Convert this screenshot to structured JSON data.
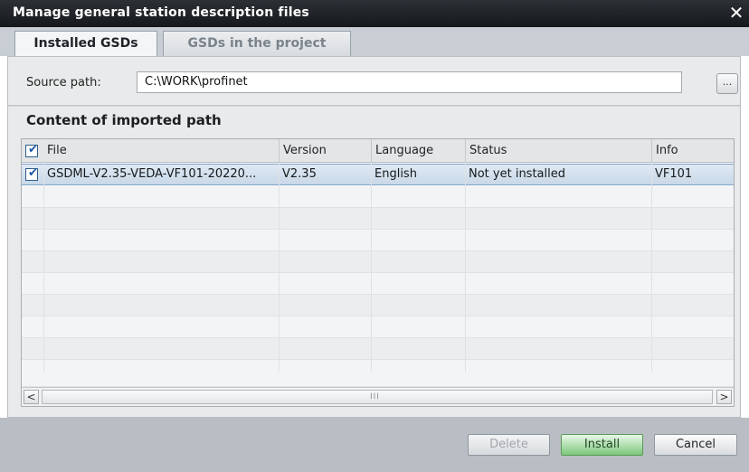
{
  "window": {
    "title": "Manage general station description files",
    "close_glyph": "✕"
  },
  "tabs": [
    {
      "label": "Installed GSDs",
      "active": true
    },
    {
      "label": "GSDs in the project",
      "active": false
    }
  ],
  "source": {
    "label": "Source path:",
    "value": "C:\\WORK\\profinet",
    "browse_label": "..."
  },
  "content": {
    "title": "Content of imported path",
    "columns": [
      "File",
      "Version",
      "Language",
      "Status",
      "Info"
    ],
    "header_checked": true,
    "rows": [
      {
        "checked": true,
        "selected": true,
        "file": "GSDML-V2.35-VEDA-VF101-20220...",
        "version": "V2.35",
        "language": "English",
        "status": "Not yet installed",
        "info": "VF101"
      }
    ]
  },
  "scrollbar": {
    "left_glyph": "<",
    "right_glyph": ">",
    "grip": "III"
  },
  "buttons": {
    "delete": "Delete",
    "install": "Install",
    "cancel": "Cancel"
  },
  "colors": {
    "titlebar": "#1e2226",
    "selection": "#c9d8e8",
    "install": "#7cc77a"
  }
}
